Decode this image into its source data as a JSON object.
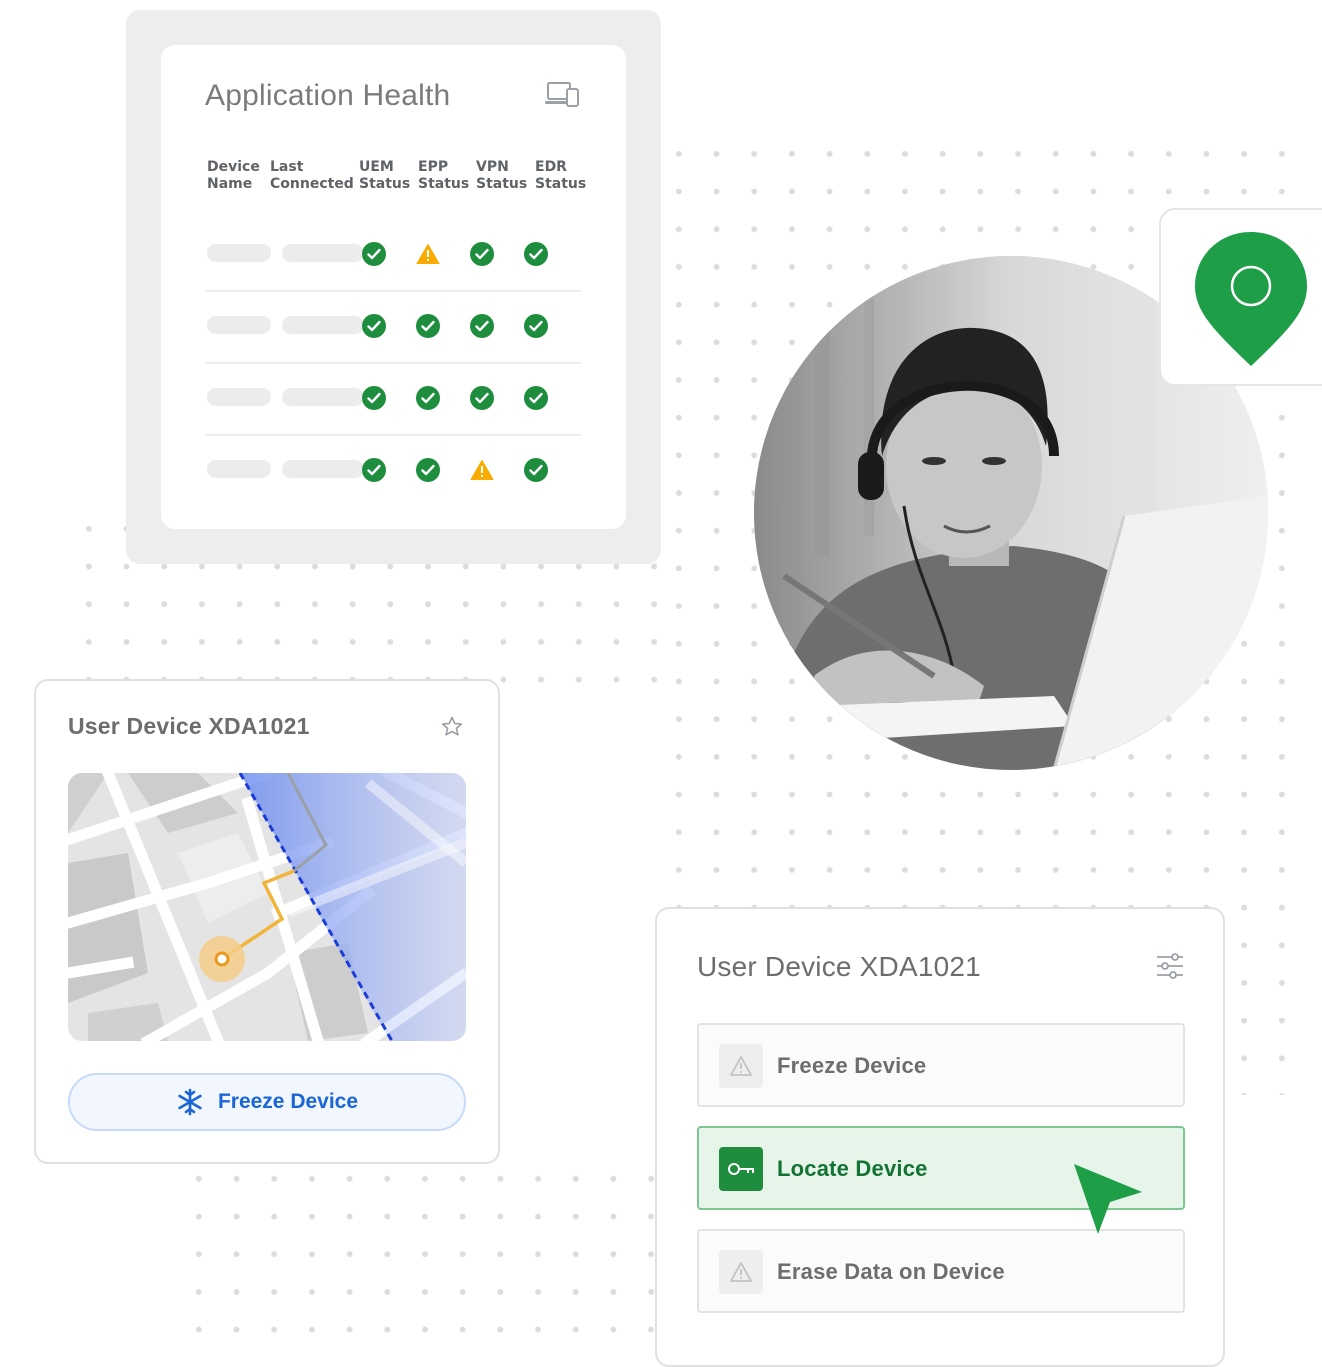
{
  "app_health": {
    "title": "Application Health",
    "icon": "devices-icon",
    "columns": [
      "Device\nName",
      "Last\nConnected",
      "UEM\nStatus",
      "EPP\nStatus",
      "VPN\nStatus",
      "EDR\nStatus"
    ],
    "rows": [
      {
        "uem": "ok",
        "epp": "warning",
        "vpn": "ok",
        "edr": "ok"
      },
      {
        "uem": "ok",
        "epp": "ok",
        "vpn": "ok",
        "edr": "ok"
      },
      {
        "uem": "ok",
        "epp": "ok",
        "vpn": "ok",
        "edr": "ok"
      },
      {
        "uem": "ok",
        "epp": "ok",
        "vpn": "warning",
        "edr": "ok"
      }
    ]
  },
  "device_map_card": {
    "title": "User Device XDA1021",
    "star_icon": "star-icon",
    "freeze_button": {
      "label": "Freeze Device",
      "icon": "snowflake-icon"
    }
  },
  "actions_card": {
    "title": "User Device XDA1021",
    "settings_icon": "tune-icon",
    "actions": [
      {
        "label": "Freeze Device",
        "icon": "warning-icon",
        "active": false
      },
      {
        "label": "Locate Device",
        "icon": "key-icon",
        "active": true
      },
      {
        "label": "Erase Data on Device",
        "icon": "warning-icon",
        "active": false
      }
    ]
  },
  "colors": {
    "green": "#1e8e3e",
    "warning": "#f9ab00",
    "blue": "#1a66d4",
    "grey_text": "#6d6d6d"
  }
}
